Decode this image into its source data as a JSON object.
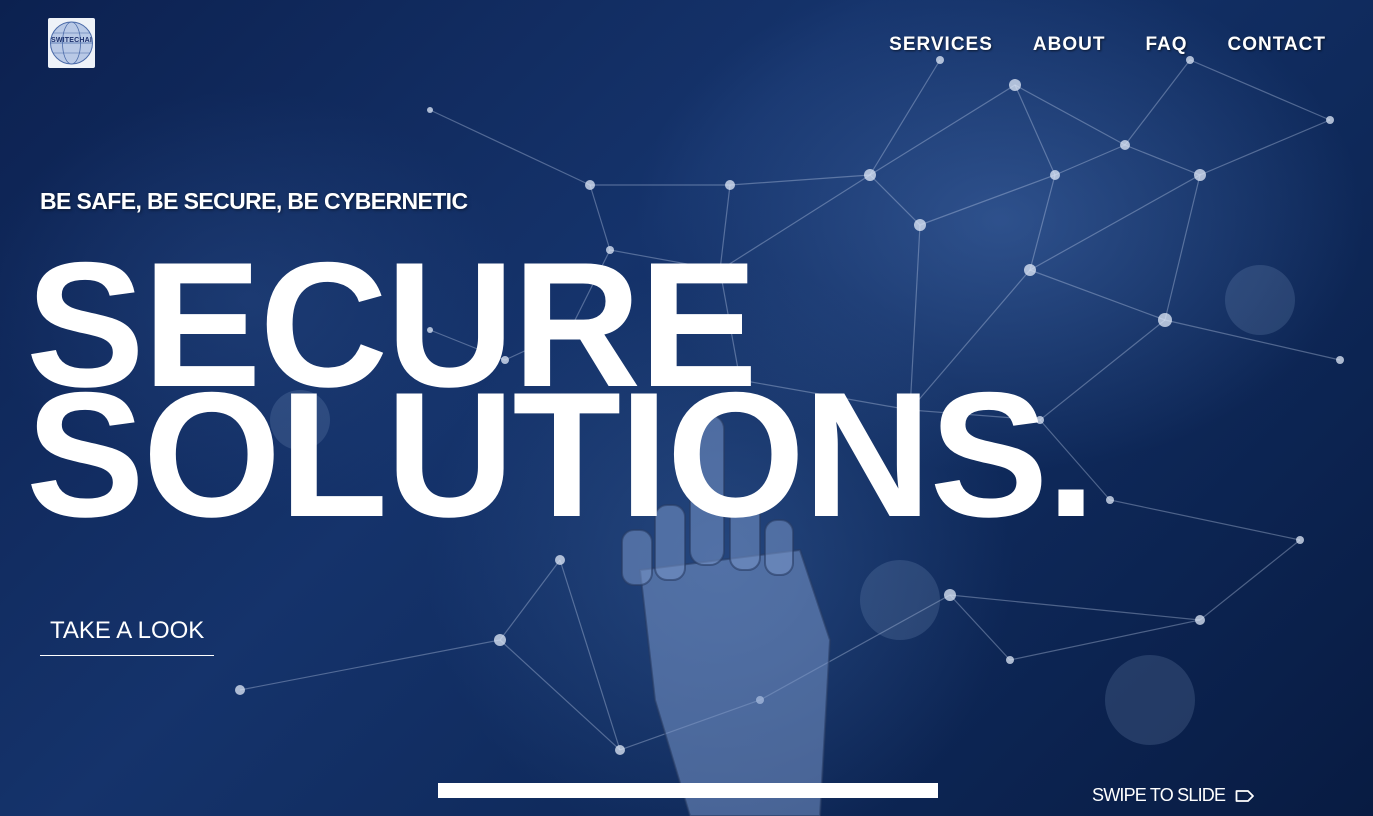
{
  "logo": {
    "text": "SWITECHAI"
  },
  "nav": {
    "items": [
      {
        "label": "SERVICES"
      },
      {
        "label": "ABOUT"
      },
      {
        "label": "FAQ"
      },
      {
        "label": "CONTACT"
      }
    ]
  },
  "hero": {
    "tagline": "BE SAFE, BE SECURE, BE CYBERNETIC",
    "line1": "SECURE",
    "line2": "SOLUTIONS.",
    "cta_label": "TAKE A LOOK"
  },
  "slider": {
    "progress_fraction": 1.0,
    "swipe_label": "SWIPE TO SLIDE",
    "swipe_icon": "arrow-tag-right-icon"
  },
  "background": {
    "subject": "robotic-hand-network-image",
    "colors": {
      "deep": "#0c2150",
      "mid": "#15336b",
      "node": "#dfe8f7"
    }
  }
}
